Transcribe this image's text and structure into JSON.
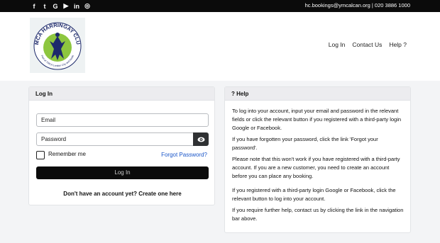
{
  "topbar": {
    "social": [
      {
        "icon": "facebook-icon",
        "glyph": "f"
      },
      {
        "icon": "twitter-icon",
        "glyph": "t"
      },
      {
        "icon": "google-icon",
        "glyph": "G"
      },
      {
        "icon": "youtube-icon",
        "glyph": "▶"
      },
      {
        "icon": "linkedin-icon",
        "glyph": "in"
      },
      {
        "icon": "instagram-icon",
        "glyph": "◎"
      }
    ],
    "contact": "hc.bookings@ymcalcan.org | 020 3886 1000"
  },
  "logo": {
    "name": "YMCA HARRINGAY CLUB",
    "tagline": "Part of YMCA London City and North"
  },
  "nav": {
    "login": "Log In",
    "contact": "Contact Us",
    "help": "Help ?"
  },
  "login": {
    "title": "Log In",
    "email_placeholder": "Email",
    "password_placeholder": "Password",
    "remember": "Remember me",
    "forgot": "Forgot Password?",
    "button": "Log In",
    "signup": "Don't have an account yet? Create one here"
  },
  "help": {
    "title": "? Help",
    "paragraphs": [
      "To log into your account, input your email and password in the relevant fields or click the relevant button if you registered with a third-party login Google or Facebook.",
      "If you have forgotten your password, click the link 'Forgot your password'.",
      "Please note that this won't work if you have registered with a third-party account. If you are a new customer, you need to create an account before you can place any booking.",
      "If you registered with a third-party login Google or Facebook, click the relevant button to log into your account.",
      "If you require further help, contact us by clicking the link in the navigation bar above."
    ]
  },
  "colors": {
    "topbar": "#0b0b0b",
    "accent_link": "#1a56c9",
    "logo_green": "#8dc63f",
    "logo_navy": "#1d2a6b"
  }
}
